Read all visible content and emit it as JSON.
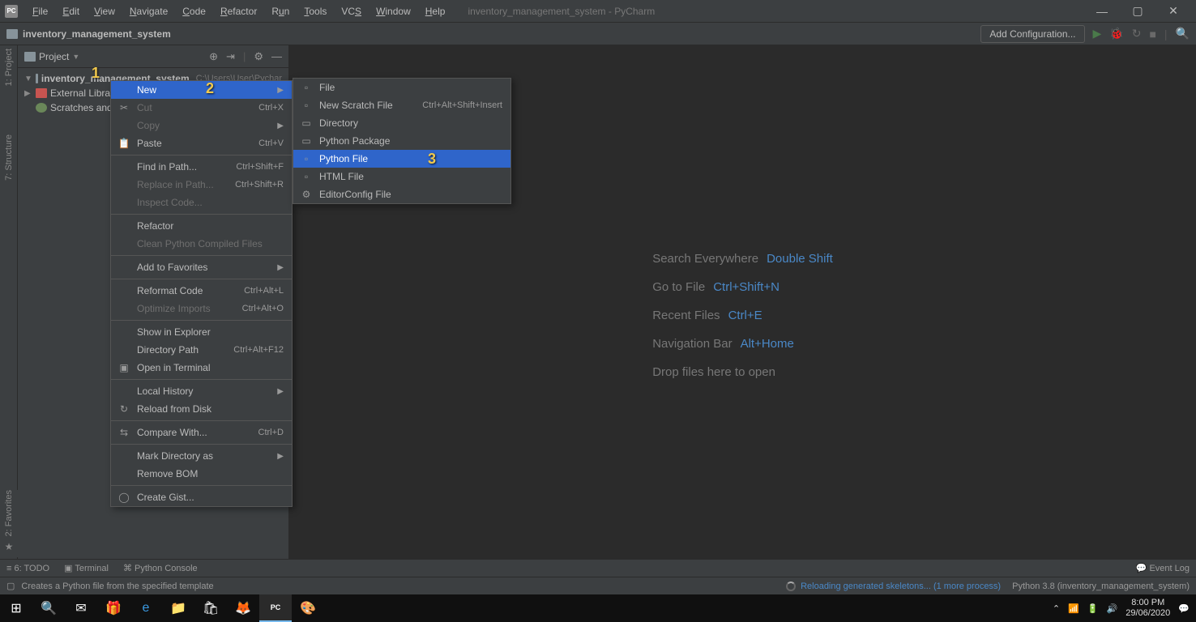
{
  "title": "inventory_management_system - PyCharm",
  "menubar": [
    "File",
    "Edit",
    "View",
    "Navigate",
    "Code",
    "Refactor",
    "Run",
    "Tools",
    "VCS",
    "Window",
    "Help"
  ],
  "breadcrumb": "inventory_management_system",
  "add_config": "Add Configuration...",
  "left_tabs": {
    "project": "1: Project",
    "structure": "7: Structure",
    "favorites": "2: Favorites"
  },
  "project_panel": {
    "title": "Project",
    "tree": {
      "root_name": "inventory_management_system",
      "root_path": "C:\\Users\\User\\Pychar",
      "ext_libs": "External Librari",
      "scratches": "Scratches and"
    }
  },
  "context_menu": {
    "items": [
      {
        "label": "New",
        "highlight": true,
        "sub": true
      },
      {
        "label": "Cut",
        "icon": "✂",
        "shortcut": "Ctrl+X",
        "disabled": true
      },
      {
        "label": "Copy",
        "disabled": true,
        "sub": true
      },
      {
        "label": "Paste",
        "icon": "📋",
        "shortcut": "Ctrl+V"
      },
      {
        "sep": true
      },
      {
        "label": "Find in Path...",
        "shortcut": "Ctrl+Shift+F"
      },
      {
        "label": "Replace in Path...",
        "shortcut": "Ctrl+Shift+R",
        "disabled": true
      },
      {
        "label": "Inspect Code...",
        "disabled": true
      },
      {
        "sep": true
      },
      {
        "label": "Refactor"
      },
      {
        "label": "Clean Python Compiled Files",
        "disabled": true
      },
      {
        "sep": true
      },
      {
        "label": "Add to Favorites",
        "sub": true
      },
      {
        "sep": true
      },
      {
        "label": "Reformat Code",
        "shortcut": "Ctrl+Alt+L"
      },
      {
        "label": "Optimize Imports",
        "shortcut": "Ctrl+Alt+O",
        "disabled": true
      },
      {
        "sep": true
      },
      {
        "label": "Show in Explorer"
      },
      {
        "label": "Directory Path",
        "shortcut": "Ctrl+Alt+F12"
      },
      {
        "label": "Open in Terminal",
        "icon": "▣"
      },
      {
        "sep": true
      },
      {
        "label": "Local History",
        "sub": true
      },
      {
        "label": "Reload from Disk",
        "icon": "↻"
      },
      {
        "sep": true
      },
      {
        "label": "Compare With...",
        "icon": "⇆",
        "shortcut": "Ctrl+D"
      },
      {
        "sep": true
      },
      {
        "label": "Mark Directory as",
        "sub": true
      },
      {
        "label": "Remove BOM"
      },
      {
        "sep": true
      },
      {
        "label": "Create Gist...",
        "icon": "◯"
      }
    ]
  },
  "submenu": {
    "items": [
      {
        "label": "File",
        "icon": "▫"
      },
      {
        "label": "New Scratch File",
        "icon": "▫",
        "shortcut": "Ctrl+Alt+Shift+Insert"
      },
      {
        "label": "Directory",
        "icon": "▭"
      },
      {
        "label": "Python Package",
        "icon": "▭"
      },
      {
        "label": "Python File",
        "icon": "▫",
        "highlight": true
      },
      {
        "label": "HTML File",
        "icon": "▫"
      },
      {
        "label": "EditorConfig File",
        "icon": "⚙"
      }
    ]
  },
  "hints": [
    {
      "label": "Search Everywhere",
      "key": "Double Shift"
    },
    {
      "label": "Go to File",
      "key": "Ctrl+Shift+N"
    },
    {
      "label": "Recent Files",
      "key": "Ctrl+E"
    },
    {
      "label": "Navigation Bar",
      "key": "Alt+Home"
    }
  ],
  "drop_hint": "Drop files here to open",
  "bottom_tools": {
    "todo": "6: TODO",
    "terminal": "Terminal",
    "console": "Python Console",
    "eventlog": "Event Log"
  },
  "status": {
    "hint": "Creates a Python file from the specified template",
    "bg_task": "Reloading generated skeletons... (1 more process)",
    "interpreter": "Python 3.8 (inventory_management_system)"
  },
  "taskbar": {
    "time": "8:00 PM",
    "date": "29/06/2020"
  },
  "annotations": {
    "a1": "1",
    "a2": "2",
    "a3": "3"
  }
}
